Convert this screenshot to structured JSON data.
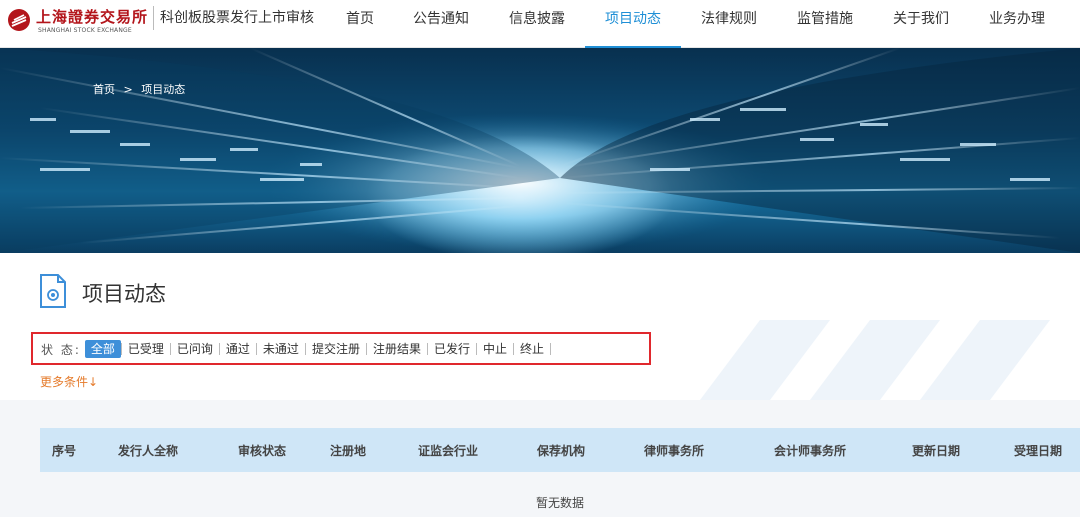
{
  "header": {
    "logo_cn": "上海證券交易所",
    "logo_en": "SHANGHAI STOCK EXCHANGE",
    "subtitle": "科创板股票发行上市审核",
    "nav": [
      {
        "label": "首页",
        "active": false
      },
      {
        "label": "公告通知",
        "active": false
      },
      {
        "label": "信息披露",
        "active": false
      },
      {
        "label": "项目动态",
        "active": true
      },
      {
        "label": "法律规则",
        "active": false
      },
      {
        "label": "监管措施",
        "active": false
      },
      {
        "label": "关于我们",
        "active": false
      },
      {
        "label": "业务办理",
        "active": false
      }
    ]
  },
  "breadcrumb": {
    "home": "首页",
    "sep": ">",
    "current": "项目动态"
  },
  "page": {
    "title": "项目动态",
    "icon": "document-at-icon"
  },
  "filter": {
    "label": "状 态:",
    "options": [
      {
        "label": "全部",
        "active": true
      },
      {
        "label": "已受理",
        "active": false
      },
      {
        "label": "已问询",
        "active": false
      },
      {
        "label": "通过",
        "active": false
      },
      {
        "label": "未通过",
        "active": false
      },
      {
        "label": "提交注册",
        "active": false
      },
      {
        "label": "注册结果",
        "active": false
      },
      {
        "label": "已发行",
        "active": false
      },
      {
        "label": "中止",
        "active": false
      },
      {
        "label": "终止",
        "active": false
      }
    ],
    "more_conditions": "更多条件↓"
  },
  "table": {
    "columns": [
      "序号",
      "发行人全称",
      "审核状态",
      "注册地",
      "证监会行业",
      "保荐机构",
      "律师事务所",
      "会计师事务所",
      "更新日期",
      "受理日期"
    ],
    "empty_text": "暂无数据"
  },
  "colors": {
    "accent": "#1f8fd6",
    "brand_red": "#b3151b",
    "highlight_box": "#e0282d",
    "more_link": "#e57a2a",
    "table_header": "#cfe6f7"
  }
}
